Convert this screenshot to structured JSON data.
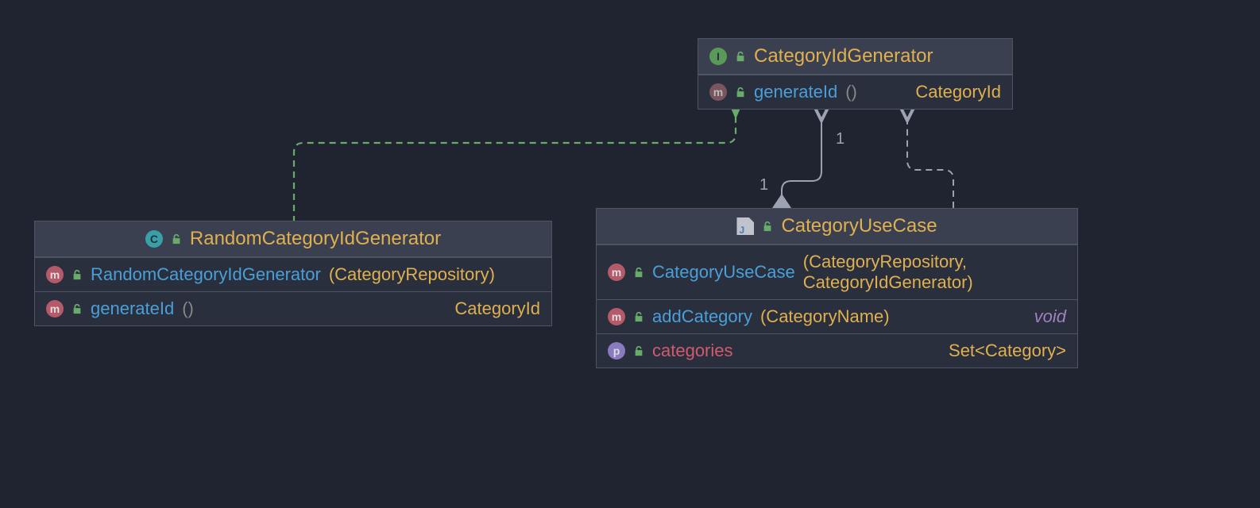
{
  "classes": {
    "interface": {
      "name": "CategoryIdGenerator",
      "rows": [
        {
          "icon": "ma",
          "name": "generateId",
          "params": "()",
          "ret": "CategoryId"
        }
      ]
    },
    "impl": {
      "name": "RandomCategoryIdGenerator",
      "rows": [
        {
          "icon": "m",
          "name": "RandomCategoryIdGenerator",
          "params": "(CategoryRepository)",
          "ret": ""
        },
        {
          "icon": "m",
          "name": "generateId",
          "params": "()",
          "ret": "CategoryId"
        }
      ]
    },
    "usecase": {
      "name": "CategoryUseCase",
      "rows": [
        {
          "icon": "m",
          "name": "CategoryUseCase",
          "params": "(CategoryRepository, CategoryIdGenerator)",
          "ret": ""
        },
        {
          "icon": "m",
          "name": "addCategory",
          "params": "(CategoryName)",
          "ret": "void",
          "retStyle": "purple"
        },
        {
          "icon": "p",
          "name": "categories",
          "nameStyle": "red",
          "params": "",
          "ret": "Set<Category>"
        }
      ]
    }
  },
  "labels": {
    "one_a": "1",
    "one_b": "1"
  }
}
